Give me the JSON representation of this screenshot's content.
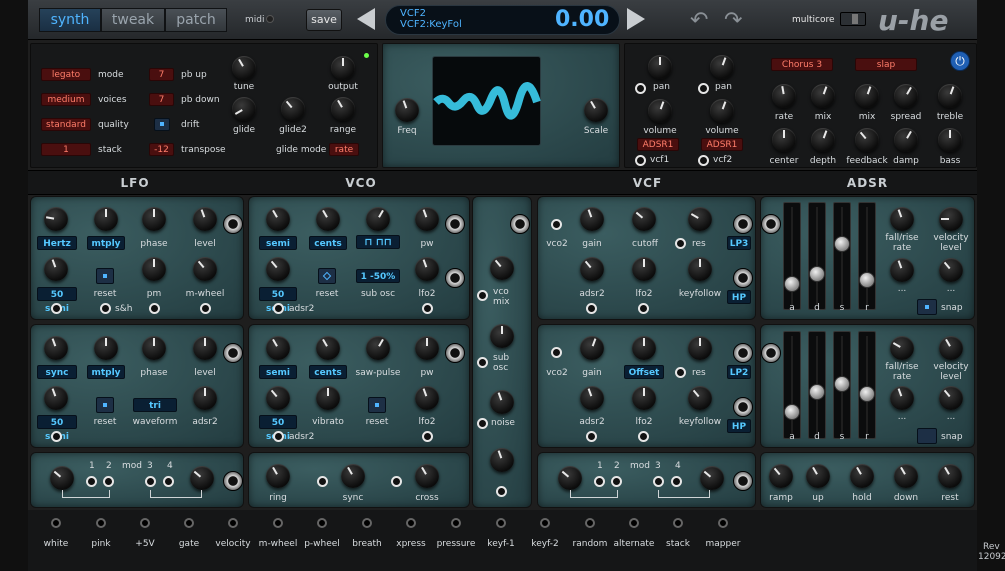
{
  "top": {
    "tabs": [
      "synth",
      "tweak",
      "patch"
    ],
    "midi_label": "midi",
    "save_label": "save",
    "display_line1": "VCF2",
    "display_line2": "VCF2:KeyFol",
    "display_value": "0.00",
    "multicore_label": "multicore",
    "logo": "u-he"
  },
  "global": {
    "mode_value": "legato",
    "mode_label": "mode",
    "voices_value": "medium",
    "voices_label": "voices",
    "quality_value": "standard",
    "quality_label": "quality",
    "stack_value": "1",
    "stack_label": "stack",
    "pbup_value": "7",
    "pbup_label": "pb up",
    "pbdown_value": "7",
    "pbdown_label": "pb down",
    "drift_label": "drift",
    "transpose_value": "-12",
    "transpose_label": "transpose",
    "tune_label": "tune",
    "output_label": "output",
    "glide_label": "glide",
    "glide2_label": "glide2",
    "range_label": "range",
    "glidemode_label": "glide mode",
    "glidemode_value": "rate"
  },
  "scope": {
    "freq_label": "Freq",
    "scale_label": "Scale"
  },
  "mixer": {
    "pan1": "pan",
    "pan2": "pan",
    "vol1": "volume",
    "vol2": "volume",
    "env1": "ADSR1",
    "env2": "ADSR1",
    "vcf1": "vcf1",
    "vcf2": "vcf2"
  },
  "fx": {
    "chorus_value": "Chorus 3",
    "delay_value": "slap",
    "labels": [
      "rate",
      "mix",
      "mix",
      "spread",
      "treble",
      "center",
      "depth",
      "feedback",
      "damp",
      "bass"
    ]
  },
  "sections": {
    "lfo": "LFO",
    "vco": "VCO",
    "vcf": "VCF",
    "adsr": "ADSR"
  },
  "lfo1": {
    "rate_unit": "Hertz",
    "mode": "mtply",
    "phase": "phase",
    "level": "level",
    "range": "50 semi",
    "reset": "reset",
    "pm": "pm",
    "mwheel": "m-wheel",
    "sh": "s&h"
  },
  "lfo2": {
    "rate_unit": "sync",
    "mode": "mtply",
    "phase": "phase",
    "level": "level",
    "range": "50 semi",
    "reset": "reset",
    "waveform_value": "tri",
    "waveform": "waveform",
    "adsr2": "adsr2"
  },
  "lfomod": {
    "n1": "1",
    "n2": "2",
    "mod": "mod",
    "n3": "3",
    "n4": "4"
  },
  "vco1": {
    "semi": "semi",
    "cents": "cents",
    "pw": "pw",
    "range": "50 semi",
    "reset": "reset",
    "subosc_value": "1 -50%",
    "subosc": "sub osc",
    "lfo2": "lfo2",
    "adsr2": "adsr2"
  },
  "vco2": {
    "semi": "semi",
    "cents": "cents",
    "sawpulse": "saw-pulse",
    "pw": "pw",
    "range": "50 semi",
    "vibrato": "vibrato",
    "reset": "reset",
    "lfo2": "lfo2",
    "adsr2": "adsr2"
  },
  "vcomod": {
    "ring": "ring",
    "sync": "sync",
    "cross": "cross"
  },
  "vcomix": {
    "vco": "vco",
    "mix": "mix",
    "sub": "sub",
    "osc": "osc",
    "noise": "noise"
  },
  "vcf1": {
    "vco2": "vco2",
    "gain": "gain",
    "cutoff": "cutoff",
    "res": "res",
    "type": "LP3",
    "adsr2": "adsr2",
    "lfo2": "lfo2",
    "keyfollow": "keyfollow",
    "hp": "HP"
  },
  "vcf2": {
    "vco2": "vco2",
    "gain": "gain",
    "offset": "Offset",
    "res": "res",
    "type": "LP2",
    "adsr2": "adsr2",
    "lfo2": "lfo2",
    "keyfollow": "keyfollow",
    "hp": "HP"
  },
  "vcfmod": {
    "n1": "1",
    "n2": "2",
    "mod": "mod",
    "n3": "3",
    "n4": "4"
  },
  "adsr1": {
    "a": "a",
    "d": "d",
    "s": "s",
    "r": "r",
    "fallrise": "fall/rise",
    "rate": "rate",
    "velocity": "velocity",
    "level": "level",
    "dots": "...",
    "snap": "snap"
  },
  "adsr2": {
    "a": "a",
    "d": "d",
    "s": "s",
    "r": "r",
    "fallrise": "fall/rise",
    "rate": "rate",
    "velocity": "velocity",
    "level": "level",
    "dots": "...",
    "snap": "snap"
  },
  "adsrmod": {
    "ramp": "ramp",
    "up": "up",
    "hold": "hold",
    "down": "down",
    "rest": "rest"
  },
  "mods": [
    "white",
    "pink",
    "+5V",
    "gate",
    "velocity",
    "m-wheel",
    "p-wheel",
    "breath",
    "xpress",
    "pressure",
    "keyf-1",
    "keyf-2",
    "random",
    "alternate",
    "stack",
    "mapper"
  ],
  "rev": {
    "line1": "Rev",
    "line2": "12092"
  }
}
